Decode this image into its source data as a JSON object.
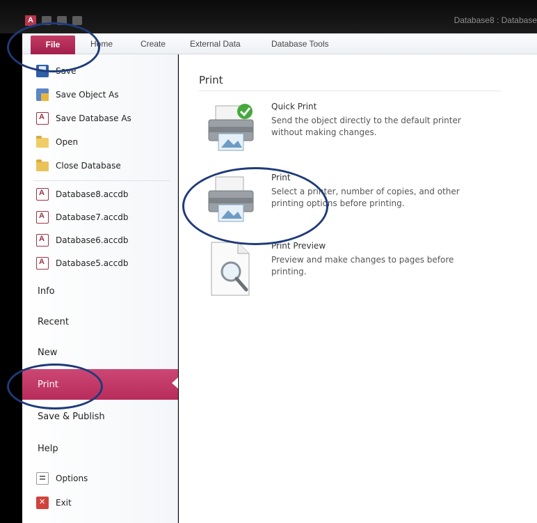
{
  "window": {
    "app_logo": "A",
    "title": "Database8 : Database"
  },
  "ribbon": {
    "tabs": [
      "File",
      "Home",
      "Create",
      "External Data",
      "Database Tools"
    ]
  },
  "nav": {
    "commands": [
      {
        "label": "Save",
        "icon": "save-icon"
      },
      {
        "label": "Save Object As",
        "icon": "save-object-icon"
      },
      {
        "label": "Save Database As",
        "icon": "access-database-icon"
      },
      {
        "label": "Open",
        "icon": "open-folder-icon"
      },
      {
        "label": "Close Database",
        "icon": "folder-icon"
      }
    ],
    "recent_files": [
      "Database8.accdb",
      "Database7.accdb",
      "Database6.accdb",
      "Database5.accdb"
    ],
    "sections": [
      "Info",
      "Recent",
      "New",
      "Print",
      "Save & Publish",
      "Help"
    ],
    "selected": "Print",
    "footer": [
      {
        "label": "Options",
        "icon": "options-icon"
      },
      {
        "label": "Exit",
        "icon": "exit-icon"
      }
    ]
  },
  "main": {
    "header": "Print",
    "options": [
      {
        "title": "Quick Print",
        "description": "Send the object directly to the default printer without making changes.",
        "icon": "quick-print-icon"
      },
      {
        "title": "Print",
        "description": "Select a printer, number of copies, and other printing options before printing.",
        "icon": "printer-icon"
      },
      {
        "title": "Print Preview",
        "description": "Preview and make changes to pages before printing.",
        "icon": "print-preview-icon"
      }
    ]
  },
  "colors": {
    "accent": "#b82c5b",
    "annotation": "#1e3b7a"
  }
}
